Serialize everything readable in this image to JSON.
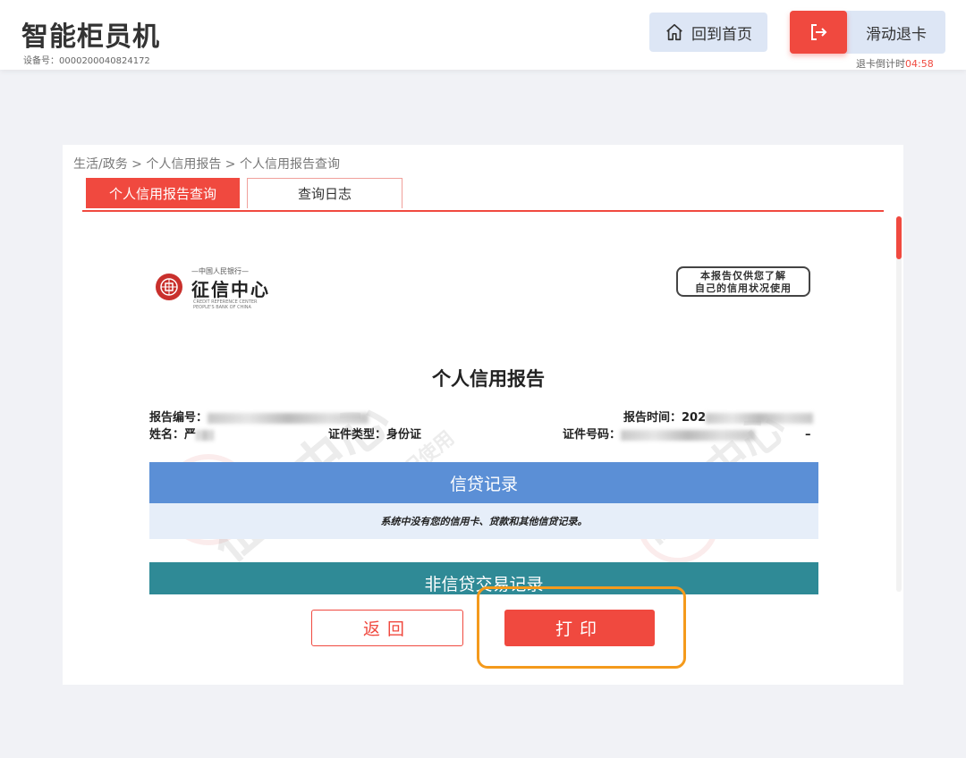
{
  "header": {
    "title": "智能柜员机",
    "device_id": "设备号：0000200040824172",
    "home_button": "回到首页",
    "eject_button": "滑动退卡",
    "countdown_label": "退卡倒计时",
    "countdown_value": "04:58"
  },
  "breadcrumb": "生活/政务 > 个人信用报告 > 个人信用报告查询",
  "tabs": [
    {
      "label": "个人信用报告查询",
      "active": true
    },
    {
      "label": "查询日志",
      "active": false
    }
  ],
  "report": {
    "logo_small": "—中国人民银行—",
    "logo_main": "征信中心",
    "logo_en_1": "CREDIT REFERENCE CENTER",
    "logo_en_2": "PEOPLE'S BANK OF CHINA",
    "notice_line1": "本报告仅供您了解",
    "notice_line2": "自己的信用状况使用",
    "title": "个人信用报告",
    "report_no_label": "报告编号：",
    "report_time_label": "报告时间：",
    "report_time_visible": "202",
    "name_label": "姓名：",
    "name_visible": "严",
    "id_type_label": "证件类型：",
    "id_type_value": "身份证",
    "id_no_label": "证件号码：",
    "id_no_suffix": "–",
    "section_credit": "信贷记录",
    "credit_note": "系统中没有您的信用卡、贷款和其他信贷记录。",
    "section_noncredit": "非信贷交易记录"
  },
  "buttons": {
    "back": "返回",
    "print": "打印"
  },
  "colors": {
    "accent": "#f0493f",
    "highlight": "#f49a1c",
    "credit_blue": "#5b8fd6",
    "noncredit_teal": "#2f8a96"
  }
}
